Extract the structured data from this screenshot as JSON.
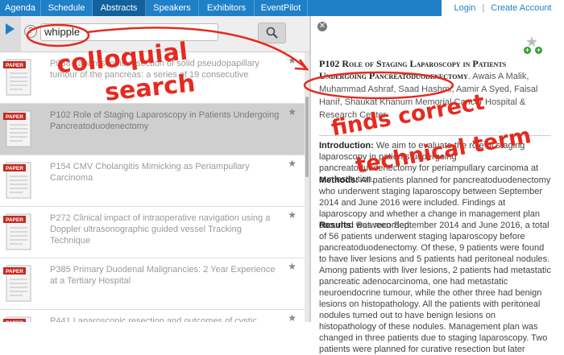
{
  "nav": {
    "tabs": [
      "Agenda",
      "Schedule",
      "Abstracts",
      "Speakers",
      "Exhibitors",
      "EventPilot"
    ],
    "active": "Abstracts",
    "login": "Login",
    "separator": "|",
    "create_account": "Create Account"
  },
  "search": {
    "value": "whipple",
    "help_label": "?"
  },
  "doc_icon_label": "PAPER",
  "list": [
    {
      "title": "P088 Laparoscopic resection of solid pseudopapillary tumour of the pancreas: a series of 19 consecutive",
      "selected": false
    },
    {
      "title": "P102 Role of Staging Laparoscopy in Patients Undergoing Pancreatoduodenectomy",
      "selected": true
    },
    {
      "title": "P154 CMV Cholangitis Mimicking as Periampullary Carcinoma",
      "selected": false
    },
    {
      "title": "P272 Clinical impact of intraoperative navigation using a Doppler ultrasonographic guided vessel Tracking Technique",
      "selected": false
    },
    {
      "title": "P385 Primary Duodenal Malignancies: 2 Year Experience at a Tertiary Hospital",
      "selected": false
    },
    {
      "title": "P441 Laparoscopic resection and outcomes of cystic",
      "selected": false
    }
  ],
  "detail": {
    "title": "P102 Role of Staging Laparoscopy in Patients Undergoing Pancreatoduodenectomy",
    "authors": ". Awais A Malik, Muhammad Ashraf, Saad Hashmi, Aamir A Syed, Faisal Hanif, Shaukat Khanum Memorial Cancer Hospital & Research Center",
    "intro_label": "Introduction:",
    "intro": "We aim to evaluate the role of staging laparoscopy in patients undergoing pancreatoduodenectomy for periampullary carcinoma at our institution.",
    "methods_label": "Methods:",
    "methods": "All patients planned for pancreatoduodenectomy who underwent staging laparoscopy between September 2014 and June 2016 were included. Findings at laparoscopy and whether a change in management plan occurred was recorded.",
    "results_label": "Results:",
    "results": "Between September 2014 and June 2016, a total of 56 patients underwent staging laparoscopy before pancreatoduodenectomy. Of these, 9 patients were found to have liver lesions and 5 patients had peritoneal nodules. Among patients with liver lesions, 2 patients had metastatic pancreatic adenocarcinoma, one had metastatic neuroendocrine tumour, while the other three had benign lesions on histopathology. All the patients with peritoneal nodules turned out to have benign lesions on histopathology of these nodules. Management plan was changed in three patients due to staging laparoscopy. Two patients were planned for curative resection but later"
  },
  "annotations": {
    "left_line1": "colloquial",
    "left_line2": "search",
    "right_line1": "finds correct",
    "right_line2": "technical term",
    "color": "#e52a20"
  }
}
